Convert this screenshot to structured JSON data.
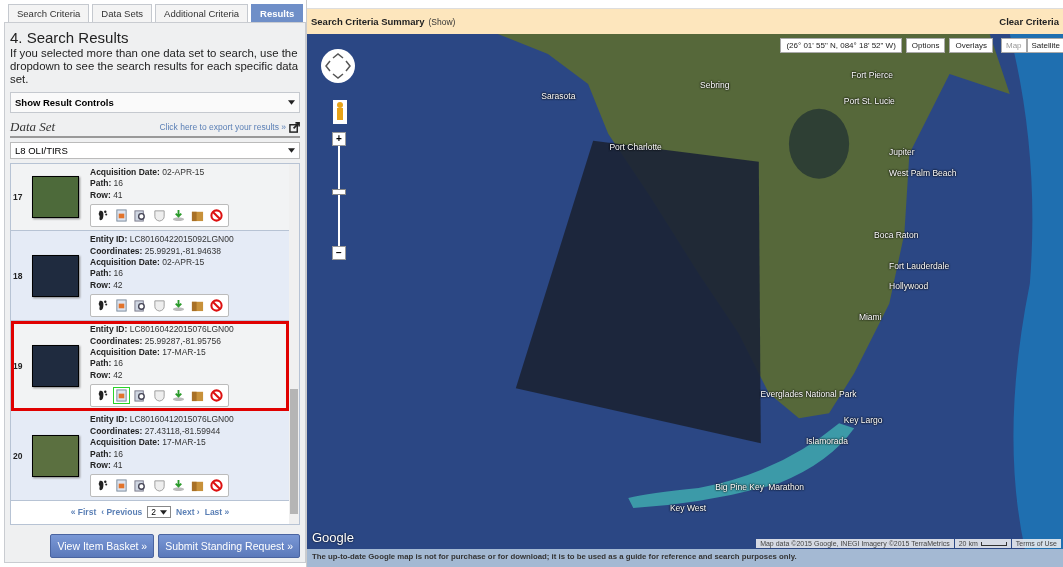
{
  "tabs": [
    {
      "label": "Search Criteria",
      "selected": false
    },
    {
      "label": "Data Sets",
      "selected": false
    },
    {
      "label": "Additional Criteria",
      "selected": false
    },
    {
      "label": "Results",
      "selected": true
    }
  ],
  "heading": "4. Search Results",
  "intro": "If you selected more than one data set to search, use the dropdown to see the search results for each specific data set.",
  "result_controls": {
    "label": "Show Result Controls"
  },
  "data_set": {
    "label": "Data Set",
    "export_link": "Click here to export your results »",
    "value": "L8 OLI/TIRS"
  },
  "results": [
    {
      "number": "17",
      "highlighted": false,
      "fields": [
        {
          "label": "Acquisition Date:",
          "value": "02-APR-15"
        },
        {
          "label": "Path:",
          "value": "16"
        },
        {
          "label": "Row:",
          "value": "41"
        }
      ],
      "tools": [
        {
          "kind": "footprint",
          "selected": false
        },
        {
          "kind": "metadata",
          "selected": false
        },
        {
          "kind": "browse",
          "selected": false
        },
        {
          "kind": "compare",
          "selected": false
        },
        {
          "kind": "download",
          "selected": false
        },
        {
          "kind": "order",
          "selected": false
        },
        {
          "kind": "exclude",
          "selected": false
        }
      ]
    },
    {
      "number": "18",
      "highlighted": false,
      "fields": [
        {
          "label": "Entity ID:",
          "value": "LC80160422015092LGN00"
        },
        {
          "label": "Coordinates:",
          "value": "25.99291,-81.94638"
        },
        {
          "label": "Acquisition Date:",
          "value": "02-APR-15"
        },
        {
          "label": "Path:",
          "value": "16"
        },
        {
          "label": "Row:",
          "value": "42"
        }
      ],
      "tools": [
        {
          "kind": "footprint",
          "selected": false
        },
        {
          "kind": "metadata",
          "selected": false
        },
        {
          "kind": "browse",
          "selected": false
        },
        {
          "kind": "compare",
          "selected": false
        },
        {
          "kind": "download",
          "selected": false
        },
        {
          "kind": "order",
          "selected": false
        },
        {
          "kind": "exclude",
          "selected": false
        }
      ]
    },
    {
      "number": "19",
      "highlighted": true,
      "fields": [
        {
          "label": "Entity ID:",
          "value": "LC80160422015076LGN00"
        },
        {
          "label": "Coordinates:",
          "value": "25.99287,-81.95756"
        },
        {
          "label": "Acquisition Date:",
          "value": "17-MAR-15"
        },
        {
          "label": "Path:",
          "value": "16"
        },
        {
          "label": "Row:",
          "value": "42"
        }
      ],
      "tools": [
        {
          "kind": "footprint",
          "selected": false
        },
        {
          "kind": "metadata",
          "selected": true
        },
        {
          "kind": "browse",
          "selected": false
        },
        {
          "kind": "compare",
          "selected": false
        },
        {
          "kind": "download",
          "selected": false
        },
        {
          "kind": "order",
          "selected": false
        },
        {
          "kind": "exclude",
          "selected": false
        }
      ]
    },
    {
      "number": "20",
      "highlighted": false,
      "fields": [
        {
          "label": "Entity ID:",
          "value": "LC80160412015076LGN00"
        },
        {
          "label": "Coordinates:",
          "value": "27.43118,-81.59944"
        },
        {
          "label": "Acquisition Date:",
          "value": "17-MAR-15"
        },
        {
          "label": "Path:",
          "value": "16"
        },
        {
          "label": "Row:",
          "value": "41"
        }
      ],
      "tools": [
        {
          "kind": "footprint",
          "selected": false
        },
        {
          "kind": "metadata",
          "selected": false
        },
        {
          "kind": "browse",
          "selected": false
        },
        {
          "kind": "compare",
          "selected": false
        },
        {
          "kind": "download",
          "selected": false
        },
        {
          "kind": "order",
          "selected": false
        },
        {
          "kind": "exclude",
          "selected": false
        }
      ]
    }
  ],
  "pagination": {
    "first": "« First",
    "previous": "‹ Previous",
    "page": "2",
    "next": "Next ›",
    "last": "Last »"
  },
  "buttons": [
    "View Item Basket »",
    "Submit Standing Request »"
  ],
  "summary_bar": {
    "title": "Search Criteria Summary",
    "toggle": "(Show)",
    "clear": "Clear Criteria"
  },
  "map": {
    "coordinates": "(26° 01' 55\" N, 084° 18' 52\" W)",
    "options": "Options",
    "overlays": "Overlays",
    "types": [
      {
        "label": "Map",
        "selected": false
      },
      {
        "label": "Satellite",
        "selected": true
      }
    ],
    "zoom_in": "+",
    "zoom_out": "−",
    "zoom": {
      "level": 0.55
    },
    "places": [
      "Sebring",
      "Sarasota",
      "Fort Pierce",
      "Port St. Lucie",
      "Port Charlotte",
      "Jupiter",
      "West Palm Beach",
      "Boca Raton",
      "Fort Lauderdale",
      "Hollywood",
      "Miami",
      "Everglades National Park",
      "Key Largo",
      "Islamorada",
      "Big Pine Key",
      "Marathon",
      "Key West"
    ],
    "logo": "Google",
    "attribution": "Map data ©2015 Google, INEGI Imagery ©2015 TerraMetrics",
    "scale": "20 km",
    "terms": "Terms of Use"
  },
  "disclaimer": "The up-to-date Google map is not for purchase or for download; it is to be used as a guide for reference and search purposes only."
}
